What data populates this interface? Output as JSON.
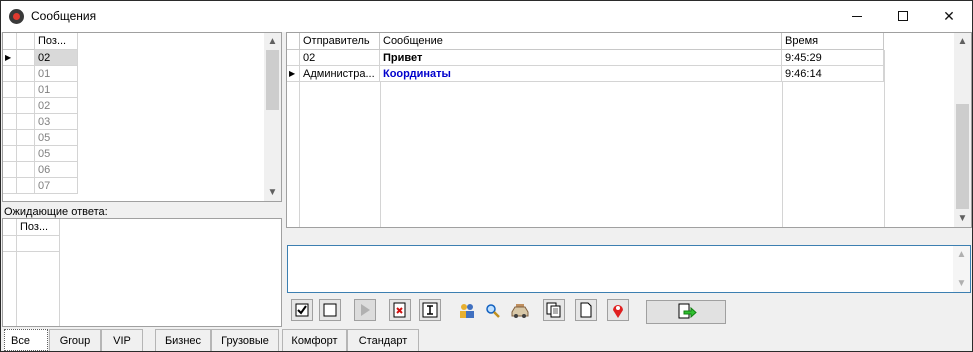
{
  "window": {
    "title": "Сообщения"
  },
  "left_grid": {
    "column": "Поз...",
    "rows": [
      "02",
      "01",
      "01",
      "02",
      "03",
      "05",
      "05",
      "06",
      "07"
    ]
  },
  "waiting": {
    "label": "Ожидающие ответа:",
    "column": "Поз..."
  },
  "messages": {
    "columns": {
      "sender": "Отправитель",
      "message": "Сообщение",
      "time": "Время"
    },
    "rows": [
      {
        "sender": "02",
        "message": "Привет",
        "time": "9:45:29",
        "color": "#000000"
      },
      {
        "sender": "Администра...",
        "message": "Координаты",
        "time": "9:46:14",
        "color": "#0000cc"
      }
    ]
  },
  "tabs": [
    "Все",
    "Group",
    "VIP",
    "Бизнес",
    "Грузовые",
    "Комфорт",
    "Стандарт"
  ],
  "toolbar_icons": [
    "checkbox-checked-icon",
    "checkbox-empty-icon",
    "play-icon",
    "document-x-icon",
    "text-box-icon",
    "users-icon",
    "magnifier-icon",
    "taxi-icon",
    "copy-icon",
    "blank-page-icon",
    "location-pin-icon"
  ],
  "send_icon": "send-document-icon"
}
